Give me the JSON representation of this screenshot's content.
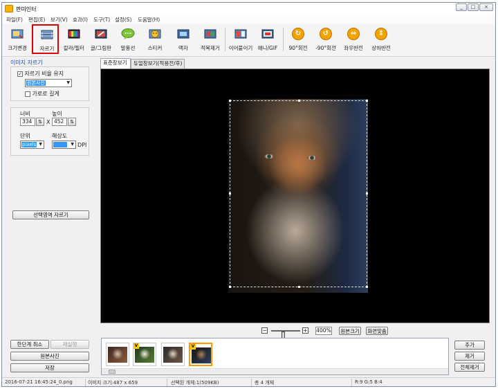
{
  "window": {
    "title": "판미인터",
    "controls": [
      "_",
      "□",
      "×"
    ]
  },
  "menu": [
    "파일(F)",
    "편집(E)",
    "보기(V)",
    "효과(I)",
    "도구(T)",
    "설정(S)",
    "도움말(H)"
  ],
  "toolbar": {
    "items": [
      {
        "label": "크기변경",
        "icon": "resize-icon"
      },
      {
        "label": "자르기",
        "icon": "crop-icon"
      },
      {
        "label": "칼라/필터",
        "icon": "color-filter-icon"
      },
      {
        "label": "글/그림판",
        "icon": "text-drawing-icon"
      },
      {
        "label": "말풍선",
        "icon": "speech-bubble-icon"
      },
      {
        "label": "스티커",
        "icon": "sticker-icon"
      },
      {
        "label": "액자",
        "icon": "frame-icon"
      },
      {
        "label": "적목제거",
        "icon": "red-eye-icon"
      },
      {
        "label": "이어붙이기",
        "icon": "merge-icon"
      },
      {
        "label": "애니/GIF",
        "icon": "gif-icon"
      },
      {
        "label": "90°회전",
        "icon": "rotate-cw-icon",
        "glyph": "↻"
      },
      {
        "label": "-90°회전",
        "icon": "rotate-ccw-icon",
        "glyph": "↺"
      },
      {
        "label": "좌우반전",
        "icon": "flip-horizontal-icon",
        "glyph": "⇔"
      },
      {
        "label": "상하반전",
        "icon": "flip-vertical-icon",
        "glyph": "⇕"
      }
    ],
    "active_index": 1
  },
  "crop_panel": {
    "title": "이미지 자르기",
    "keep_ratio": {
      "label": "자르기 비율 유지",
      "checked": true
    },
    "ratio_value": "원본사진",
    "portrait": {
      "label": "가로로 길게",
      "checked": false
    },
    "width_label": "너비",
    "height_label": "높이",
    "width_value": "334",
    "height_value": "452",
    "times": "X",
    "unit_label": "단위",
    "dpi_label": "해상도",
    "unit_value": "pixels",
    "dpi_suffix": "DPI",
    "crop_selection_button": "선택영역 자르기"
  },
  "bottom_left": {
    "undo": "한단계 취소",
    "redo": "재실행",
    "original": "원본사진",
    "save": "저장"
  },
  "view_tabs": [
    "표준창보기",
    "듀얼창보기(적용전/후)"
  ],
  "zoom": {
    "value": "400%",
    "percent": 40,
    "original_size": "원본크기",
    "fit_screen": "화면맞춤"
  },
  "thumbnails": [
    {
      "name": "thumb-1",
      "colors": [
        "#3a2a20",
        "#d7c4ae",
        "#8c5a3c"
      ]
    },
    {
      "name": "thumb-2",
      "colors": [
        "#1e3b18",
        "#f2efe0",
        "#5a7a3a"
      ]
    },
    {
      "name": "thumb-3",
      "colors": [
        "#2a2a2a",
        "#e3d6c2",
        "#6e5646"
      ]
    },
    {
      "name": "thumb-4",
      "colors": [
        "#1a120c",
        "#b08058",
        "#2d3f60"
      ]
    }
  ],
  "thumb_actions": {
    "add": "추가",
    "remove": "제거",
    "remove_all": "전체제거"
  },
  "status": {
    "file": "2016-07-21 16:45:24_0.png",
    "image_size": "이미지 크기:487 x 659",
    "selection": "선택된 개체:1(509KB)",
    "total": "총 4 개체",
    "rgb": "R:9 G:5 B:4"
  },
  "colors": {
    "accent": "#1f4fbf",
    "active_border": "#e00000",
    "thumb_active": "#ff9a00"
  }
}
